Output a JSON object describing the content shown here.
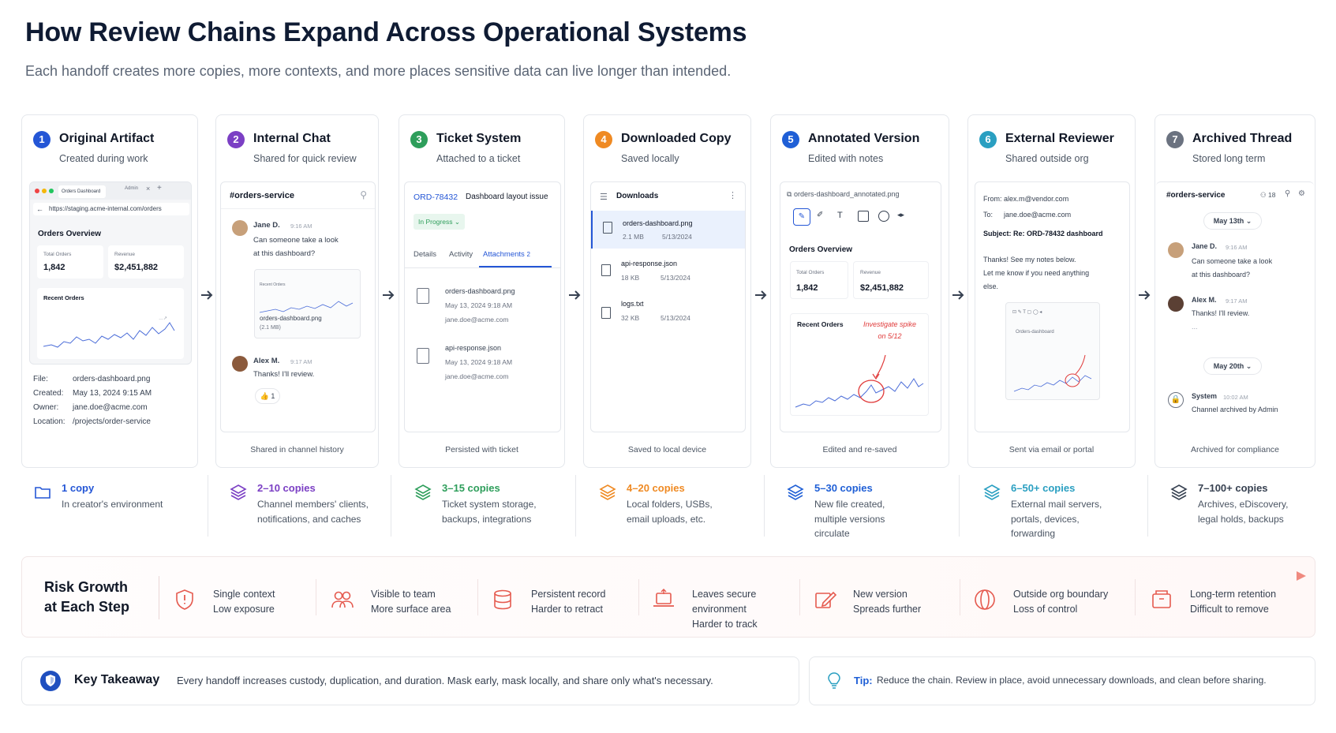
{
  "title": "How Review Chains Expand Across Operational Systems",
  "subtitle": "Each handoff creates more copies, more contexts, and more places sensitive data can live longer than intended.",
  "steps": [
    {
      "num": "1",
      "title": "Original Artifact",
      "subtitle": "Created during work",
      "footer": "",
      "color": "#2456d6"
    },
    {
      "num": "2",
      "title": "Internal Chat",
      "subtitle": "Shared for quick review",
      "footer": "Shared in channel history",
      "color": "#7b3fc4"
    },
    {
      "num": "3",
      "title": "Ticket System",
      "subtitle": "Attached to a ticket",
      "footer": "Persisted with ticket",
      "color": "#2e9e5b"
    },
    {
      "num": "4",
      "title": "Downloaded Copy",
      "subtitle": "Saved locally",
      "footer": "Saved to local device",
      "color": "#ef8a23"
    },
    {
      "num": "5",
      "title": "Annotated Version",
      "subtitle": "Edited with notes",
      "footer": "Edited and re-saved",
      "color": "#1f5fd6"
    },
    {
      "num": "6",
      "title": "External Reviewer",
      "subtitle": "Shared outside org",
      "footer": "Sent via email or portal",
      "color": "#2a9fc1"
    },
    {
      "num": "7",
      "title": "Archived Thread",
      "subtitle": "Stored long term",
      "footer": "Archived for compliance",
      "color": "#6b7280"
    }
  ],
  "mock1": {
    "tab_title": "Orders Dashboard",
    "tab_admin": "Admin",
    "tab_x": "×",
    "tab_plus": "+",
    "url": "https://staging.acme-internal.com/orders",
    "heading": "Orders Overview",
    "stat1_label": "Total Orders",
    "stat1_value": "1,842",
    "stat2_label": "Revenue",
    "stat2_value": "$2,451,882",
    "recent": "Recent Orders",
    "meta": [
      {
        "k": "File:",
        "v": "orders-dashboard.png"
      },
      {
        "k": "Created:",
        "v": "May 13, 2024 9:15 AM"
      },
      {
        "k": "Owner:",
        "v": "jane.doe@acme.com"
      },
      {
        "k": "Location:",
        "v": "/projects/order-service"
      }
    ]
  },
  "mock2": {
    "channel": "#orders-service",
    "pin": "⚲",
    "msg1_name": "Jane D.",
    "msg1_time": "9:16 AM",
    "msg1_text": "Can someone take a look\nat this dashboard?",
    "attach_name": "orders-dashboard.png",
    "attach_size": "(2.1 MB)",
    "attach_title": "Recent Orders",
    "msg2_name": "Alex M.",
    "msg2_time": "9:17 AM",
    "msg2_text": "Thanks! I'll review.",
    "reaction_emoji": "👍",
    "reaction_count": "1"
  },
  "mock3": {
    "ticket_id": "ORD-78432",
    "ticket_title": "Dashboard layout issue",
    "status": "In Progress",
    "status_caret": "⌄",
    "tabs": [
      "Details",
      "Activity",
      "Attachments"
    ],
    "attach_count": "2",
    "files": [
      {
        "name": "orders-dashboard.png",
        "date": "May 13, 2024 9:18 AM",
        "user": "jane.doe@acme.com"
      },
      {
        "name": "api-response.json",
        "date": "May 13, 2024 9:18 AM",
        "user": "jane.doe@acme.com"
      }
    ]
  },
  "mock4": {
    "folder": "Downloads",
    "kebab": "⋮",
    "files": [
      {
        "name": "orders-dashboard.png",
        "size": "2.1 MB",
        "date": "5/13/2024"
      },
      {
        "name": "api-response.json",
        "size": "18 KB",
        "date": "5/13/2024"
      },
      {
        "name": "logs.txt",
        "size": "32 KB",
        "date": "5/13/2024"
      }
    ]
  },
  "mock5": {
    "filename": "orders-dashboard_annotated.png",
    "heading": "Orders Overview",
    "stat1_label": "Total Orders",
    "stat1_value": "1,842",
    "stat2_label": "Revenue",
    "stat2_value": "$2,451,882",
    "recent": "Recent Orders",
    "note": "Investigate spike\non 5/12"
  },
  "mock6": {
    "from_label": "From:",
    "from": "alex.m@vendor.com",
    "to_label": "To:",
    "to": "jane.doe@acme.com",
    "subject": "Subject: Re: ORD-78432 dashboard",
    "body": "Thanks! See my notes below.\nLet me know if you need anything\nelse.",
    "thumb_title": "Orders-dashboard"
  },
  "mock7": {
    "channel": "#orders-service",
    "members": "18",
    "date1": "May 13th",
    "date_caret": "⌄",
    "msg1_name": "Jane D.",
    "msg1_time": "9:16 AM",
    "msg1_text": "Can someone take a look\nat this dashboard?",
    "msg2_name": "Alex M.",
    "msg2_time": "9:17 AM",
    "msg2_text": "Thanks! I'll review.",
    "ellipsis": "...",
    "date2": "May 20th",
    "sys_name": "System",
    "sys_time": "10:02 AM",
    "sys_text": "Channel archived by Admin"
  },
  "copies": [
    {
      "title": "1 copy",
      "desc": "In creator's environment",
      "color": "#2456d6"
    },
    {
      "title": "2–10 copies",
      "desc": "Channel members' clients,\nnotifications, and caches",
      "color": "#7b3fc4"
    },
    {
      "title": "3–15 copies",
      "desc": "Ticket system storage,\nbackups, integrations",
      "color": "#2e9e5b"
    },
    {
      "title": "4–20 copies",
      "desc": "Local folders, USBs,\nemail uploads, etc.",
      "color": "#ef8a23"
    },
    {
      "title": "5–30 copies",
      "desc": "New file created,\nmultiple versions\ncirculate",
      "color": "#1f5fd6"
    },
    {
      "title": "6–50+ copies",
      "desc": "External mail servers,\nportals, devices,\nforwarding",
      "color": "#2a9fc1"
    },
    {
      "title": "7–100+ copies",
      "desc": "Archives, eDiscovery,\nlegal holds, backups",
      "color": "#374151"
    }
  ],
  "risk": {
    "title": "Risk Growth\nat Each Step",
    "items": [
      {
        "text": "Single context\nLow exposure",
        "icon": "shield-alert-icon"
      },
      {
        "text": "Visible to team\nMore surface area",
        "icon": "team-icon"
      },
      {
        "text": "Persistent record\nHarder to retract",
        "icon": "database-icon"
      },
      {
        "text": "Leaves secure\nenvironment\nHarder to track",
        "icon": "laptop-icon"
      },
      {
        "text": "New version\nSpreads further",
        "icon": "edit-icon"
      },
      {
        "text": "Outside org boundary\nLoss of control",
        "icon": "globe-icon"
      },
      {
        "text": "Long-term retention\nDifficult to remove",
        "icon": "archive-box-icon"
      }
    ],
    "color": "#e55a4f"
  },
  "takeaway": {
    "label": "Key Takeaway",
    "text": "Every handoff increases custody, duplication, and duration. Mask early, mask locally, and share only what's necessary."
  },
  "tip": {
    "label": "Tip:",
    "text": "Reduce the chain. Review in place, avoid unnecessary downloads, and clean before sharing."
  }
}
